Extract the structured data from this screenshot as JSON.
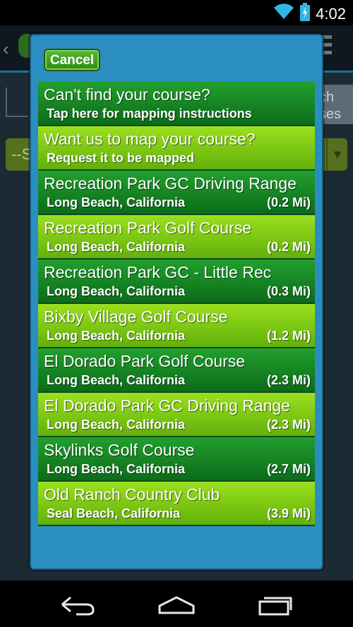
{
  "status_bar": {
    "time": "4:02",
    "icons": [
      "wifi-icon",
      "battery-charging-icon"
    ]
  },
  "background_app": {
    "search_text": "ch\nses",
    "select_text": "--S"
  },
  "dialog": {
    "cancel_label": "Cancel",
    "items": [
      {
        "title": "Can't find your course?",
        "subtitle": "Tap here for mapping instructions",
        "distance": "",
        "style": "dark"
      },
      {
        "title": "Want us to map your course?",
        "subtitle": "Request it to be mapped",
        "distance": "",
        "style": "light"
      },
      {
        "title": "Recreation Park GC Driving Range",
        "subtitle": "Long Beach, California",
        "distance": "(0.2 Mi)",
        "style": "dark"
      },
      {
        "title": "Recreation Park Golf Course",
        "subtitle": "Long Beach, California",
        "distance": "(0.2 Mi)",
        "style": "light"
      },
      {
        "title": "Recreation Park GC - Little Rec",
        "subtitle": "Long Beach, California",
        "distance": "(0.3 Mi)",
        "style": "dark"
      },
      {
        "title": "Bixby Village Golf Course",
        "subtitle": "Long Beach, California",
        "distance": "(1.2 Mi)",
        "style": "light"
      },
      {
        "title": "El Dorado Park Golf Course",
        "subtitle": "Long Beach, California",
        "distance": "(2.3 Mi)",
        "style": "dark"
      },
      {
        "title": "El Dorado Park GC Driving Range",
        "subtitle": "Long Beach, California",
        "distance": "(2.3 Mi)",
        "style": "light"
      },
      {
        "title": "Skylinks Golf Course",
        "subtitle": "Long Beach, California",
        "distance": "(2.7 Mi)",
        "style": "dark"
      },
      {
        "title": "Old Ranch Country Club",
        "subtitle": "Seal Beach, California",
        "distance": "(3.9 Mi)",
        "style": "light"
      }
    ]
  },
  "nav_bar": {
    "buttons": [
      "back-icon",
      "home-icon",
      "recents-icon"
    ]
  },
  "colors": {
    "dialog_frame": "#2b8ec0",
    "row_dark": "#0c6b1a",
    "row_light": "#62b10b",
    "status_icon": "#33b5e5"
  }
}
